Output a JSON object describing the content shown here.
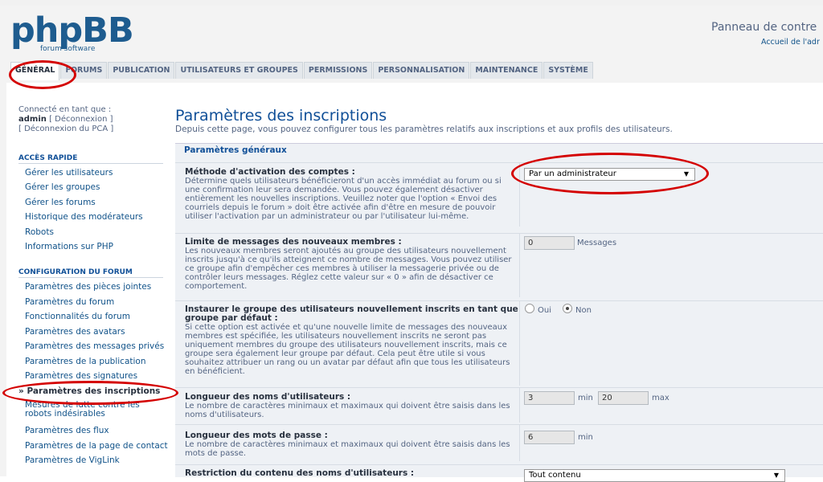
{
  "logo": {
    "text": "phpBB",
    "sub": "forum software"
  },
  "header": {
    "title": "Panneau de contre",
    "link": "Accueil de l'adr"
  },
  "tabs": [
    "GÉNÉRAL",
    "FORUMS",
    "PUBLICATION",
    "UTILISATEURS ET GROUPES",
    "PERMISSIONS",
    "PERSONNALISATION",
    "MAINTENANCE",
    "SYSTÈME"
  ],
  "sidebar": {
    "connected": "Connecté en tant que :",
    "user": "admin",
    "logout": "[ Déconnexion ]",
    "logout_acp": "[ Déconnexion du PCA ]",
    "quick_title": "ACCÈS RAPIDE",
    "quick": [
      "Gérer les utilisateurs",
      "Gérer les groupes",
      "Gérer les forums",
      "Historique des modérateurs",
      "Robots",
      "Informations sur PHP"
    ],
    "config_title": "CONFIGURATION DU FORUM",
    "config": [
      "Paramètres des pièces jointes",
      "Paramètres du forum",
      "Fonctionnalités du forum",
      "Paramètres des avatars",
      "Paramètres des messages privés",
      "Paramètres de la publication",
      "Paramètres des signatures",
      "» Paramètres des inscriptions",
      "Mesures de lutte contre les",
      "robots indésirables",
      "Paramètres des flux",
      "Paramètres de la page de contact",
      "Paramètres de VigLink"
    ]
  },
  "main": {
    "title": "Paramètres des inscriptions",
    "desc": "Depuis cette page, vous pouvez configurer tous les paramètres relatifs aux inscriptions et aux profils des utilisateurs.",
    "legend": "Paramètres généraux",
    "activation": {
      "label": "Méthode d'activation des comptes :",
      "desc": "Détermine quels utilisateurs bénéficieront d'un accès immédiat au forum ou si une confirmation leur sera demandée. Vous pouvez également désactiver entièrement les nouvelles inscriptions. Veuillez noter que l'option « Envoi des courriels depuis le forum » doit être activée afin d'être en mesure de pouvoir utiliser l'activation par un administrateur ou par l'utilisateur lui-même.",
      "value": "Par un administrateur"
    },
    "newposts": {
      "label": "Limite de messages des nouveaux membres :",
      "desc": "Les nouveaux membres seront ajoutés au groupe des utilisateurs nouvellement inscrits jusqu'à ce qu'ils atteignent ce nombre de messages. Vous pouvez utiliser ce groupe afin d'empêcher ces membres à utiliser la messagerie privée ou de contrôler leurs messages. Réglez cette valeur sur « 0 » afin de désactiver ce comportement.",
      "value": "0",
      "unit": "Messages"
    },
    "default_group": {
      "label": "Instaurer le groupe des utilisateurs nouvellement inscrits en tant que groupe par défaut :",
      "desc": "Si cette option est activée et qu'une nouvelle limite de messages des nouveaux membres est spécifiée, les utilisateurs nouvellement inscrits ne seront pas uniquement membres du groupe des utilisateurs nouvellement inscrits, mais ce groupe sera également leur groupe par défaut. Cela peut être utile si vous souhaitez attribuer un rang ou un avatar par défaut afin que tous les utilisateurs en bénéficient.",
      "yes": "Oui",
      "no": "Non"
    },
    "name_len": {
      "label": "Longueur des noms d'utilisateurs :",
      "desc": "Le nombre de caractères minimaux et maximaux qui doivent être saisis dans les noms d'utilisateurs.",
      "min": "3",
      "min_label": "min",
      "max": "20",
      "max_label": "max"
    },
    "pass_len": {
      "label": "Longueur des mots de passe :",
      "desc": "Le nombre de caractères minimaux et maximaux qui doivent être saisis dans les mots de passe.",
      "min": "6",
      "min_label": "min"
    },
    "restrict": {
      "label": "Restriction du contenu des noms d'utilisateurs :",
      "value": "Tout contenu"
    }
  }
}
